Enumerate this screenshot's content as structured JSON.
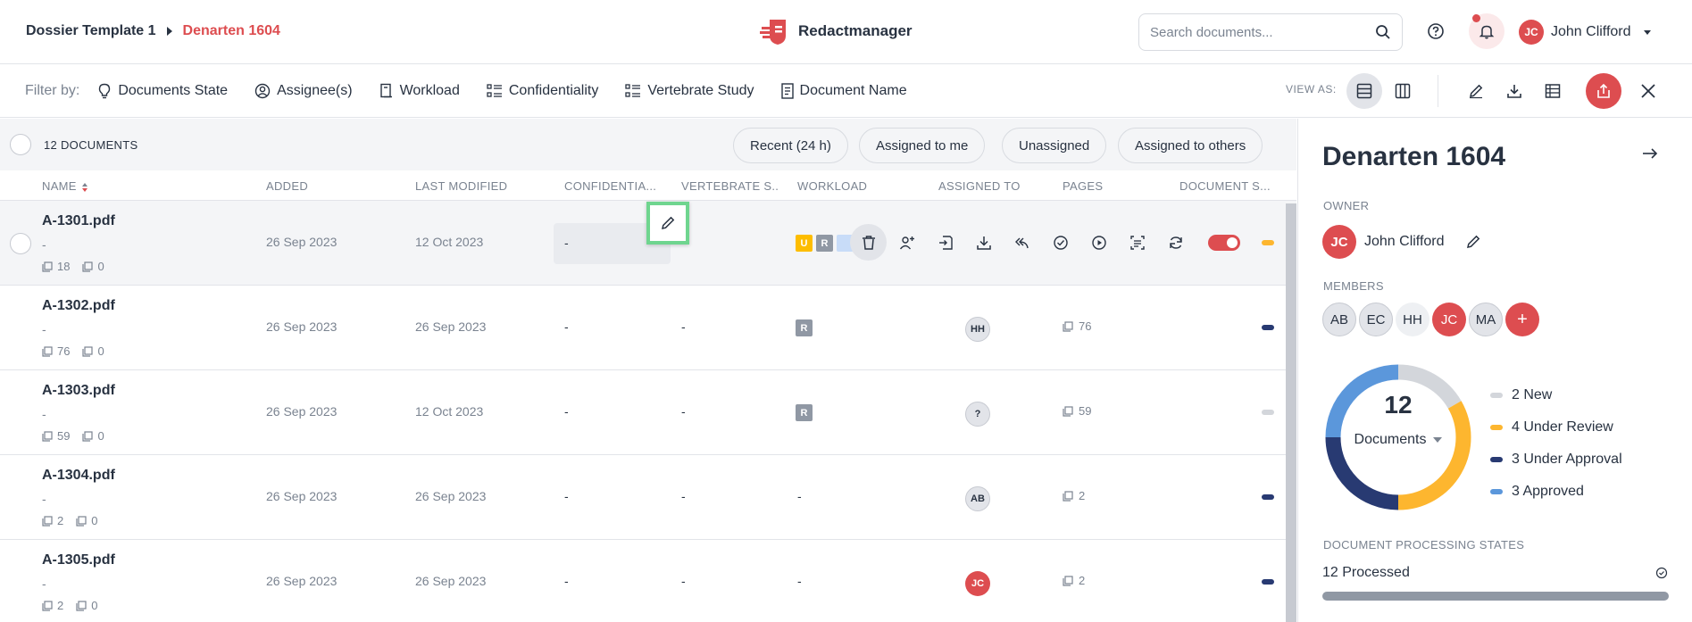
{
  "breadcrumb": {
    "parent": "Dossier Template 1",
    "current": "Denarten 1604"
  },
  "app": {
    "name": "Redactmanager"
  },
  "search": {
    "placeholder": "Search documents..."
  },
  "user": {
    "initials": "JC",
    "name": "John Clifford"
  },
  "filter": {
    "label": "Filter by:",
    "items": [
      {
        "label": "Documents State",
        "icon": "lightbulb-icon"
      },
      {
        "label": "Assignee(s)",
        "icon": "user-circle-icon"
      },
      {
        "label": "Workload",
        "icon": "workload-icon"
      },
      {
        "label": "Confidentiality",
        "icon": "list-icon"
      },
      {
        "label": "Vertebrate Study",
        "icon": "list-icon"
      },
      {
        "label": "Document Name",
        "icon": "document-icon"
      }
    ]
  },
  "view_as": "VIEW AS:",
  "list": {
    "count": "12 DOCUMENTS",
    "quick_filters": [
      "Recent (24 h)",
      "Assigned to me",
      "Unassigned",
      "Assigned to others"
    ],
    "columns": [
      "NAME",
      "ADDED",
      "LAST MODIFIED",
      "CONFIDENTIA...",
      "VERTEBRATE S...",
      "WORKLOAD",
      "ASSIGNED TO",
      "PAGES",
      "DOCUMENT S..."
    ],
    "rows": [
      {
        "name": "A-1301.pdf",
        "sub": "-",
        "pages_meta": "18",
        "annotations": "0",
        "added": "26 Sep 2023",
        "modified": "12 Oct 2023",
        "confidentiality": "-",
        "vertebrate": "-",
        "state_color": "#fdb62f"
      },
      {
        "name": "A-1302.pdf",
        "sub": "-",
        "pages_meta": "76",
        "annotations": "0",
        "added": "26 Sep 2023",
        "modified": "26 Sep 2023",
        "confidentiality": "-",
        "vertebrate": "-",
        "workload": "R",
        "assignee": "HH",
        "pages": "76",
        "state_color": "#283a72"
      },
      {
        "name": "A-1303.pdf",
        "sub": "-",
        "pages_meta": "59",
        "annotations": "0",
        "added": "26 Sep 2023",
        "modified": "12 Oct 2023",
        "confidentiality": "-",
        "vertebrate": "-",
        "workload": "R",
        "assignee": "?",
        "pages": "59",
        "state_color": "#d3d6db"
      },
      {
        "name": "A-1304.pdf",
        "sub": "-",
        "pages_meta": "2",
        "annotations": "0",
        "added": "26 Sep 2023",
        "modified": "26 Sep 2023",
        "confidentiality": "-",
        "vertebrate": "-",
        "workload": "-",
        "assignee": "AB",
        "pages": "2",
        "state_color": "#283a72"
      },
      {
        "name": "A-1305.pdf",
        "sub": "-",
        "pages_meta": "2",
        "annotations": "0",
        "added": "26 Sep 2023",
        "modified": "26 Sep 2023",
        "confidentiality": "-",
        "vertebrate": "-",
        "workload": "-",
        "assignee": "JC",
        "pages": "2",
        "state_color": "#283a72"
      }
    ],
    "row1_badges": [
      "U",
      "R"
    ]
  },
  "panel": {
    "title": "Denarten 1604",
    "owner_label": "OWNER",
    "owner": {
      "initials": "JC",
      "name": "John Clifford"
    },
    "members_label": "MEMBERS",
    "members": [
      "AB",
      "EC",
      "HH",
      "JC",
      "MA"
    ],
    "chart": {
      "total": "12",
      "label": "Documents",
      "segments": [
        {
          "label": "2 New",
          "value": 2,
          "color": "#d3d6db"
        },
        {
          "label": "4 Under Review",
          "value": 4,
          "color": "#fdb62f"
        },
        {
          "label": "3 Under Approval",
          "value": 3,
          "color": "#283a72"
        },
        {
          "label": "3 Approved",
          "value": 3,
          "color": "#5b97db"
        }
      ]
    },
    "processing_label": "DOCUMENT PROCESSING STATES",
    "processed": "12 Processed",
    "processed_fraction": 1.0
  }
}
